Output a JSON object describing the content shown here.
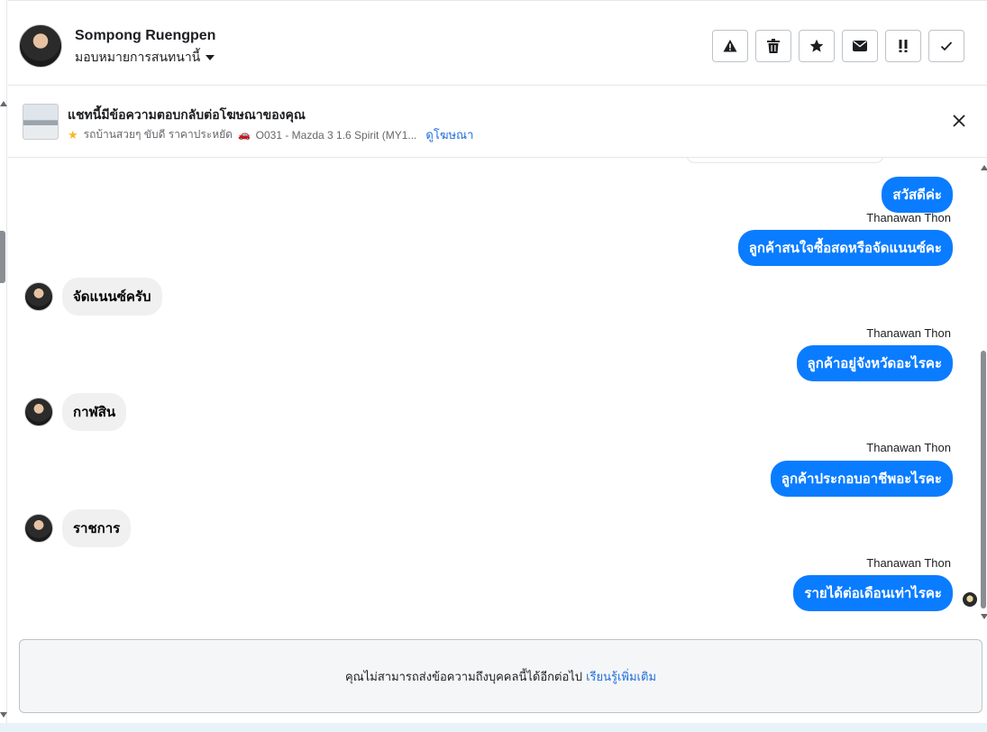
{
  "header": {
    "contact_name": "Sompong Ruengpen",
    "assign_label": "มอบหมายการสนทนานี้",
    "actions": [
      {
        "icon": "warning-icon",
        "glyph": "⚠"
      },
      {
        "icon": "trash-icon",
        "glyph": "🗑"
      },
      {
        "icon": "star-icon",
        "glyph": "★"
      },
      {
        "icon": "envelope-icon",
        "glyph": "✉"
      },
      {
        "icon": "follow-up-icon",
        "glyph": "!!"
      },
      {
        "icon": "checkmark-icon",
        "glyph": "✓"
      }
    ]
  },
  "ad_banner": {
    "title": "แชทนี้มีข้อความตอบกลับต่อโฆษณาของคุณ",
    "subtitle": "รถบ้านสวยๆ ขับดี ราคาประหยัด",
    "car_text": "O031 - Mazda 3 1.6 Spirit (MY1...",
    "link_label": "ดูโฆษณา",
    "star_glyph": "★",
    "car_glyph": "🚗"
  },
  "messages": {
    "m1": {
      "text": "สวัสดีค่ะ"
    },
    "m2": {
      "sender": "Thanawan Thon",
      "text": "ลูกค้าสนใจซื้อสดหรือจัดแนนซ์คะ"
    },
    "m3": {
      "text": "จัดแนนซ์ครับ"
    },
    "m4": {
      "sender": "Thanawan Thon",
      "text": "ลูกค้าอยู่จังหวัดอะไรคะ"
    },
    "m5": {
      "text": "กาฬสิน"
    },
    "m6": {
      "sender": "Thanawan Thon",
      "text": "ลูกค้าประกอบอาชีพอะไรคะ"
    },
    "m7": {
      "text": "ราชการ"
    },
    "m8": {
      "sender": "Thanawan Thon",
      "text": "รายได้ต่อเดือนเท่าไรคะ"
    }
  },
  "composer_blocked": {
    "text": "คุณไม่สามารถส่งข้อความถึงบุคคลนี้ได้อีกต่อไป",
    "link_label": "เรียนรู้เพิ่มเติม"
  },
  "colors": {
    "outgoing_bubble": "#0a7cff",
    "incoming_bubble": "#f0f0f0",
    "link": "#216fdb"
  }
}
